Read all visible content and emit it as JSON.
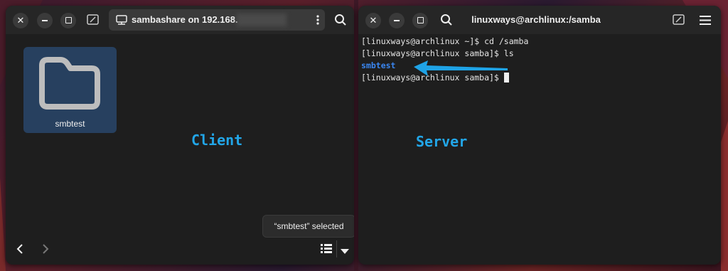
{
  "file_manager": {
    "path_label": "sambashare on 192.168.",
    "folder_name": "smbtest",
    "annotation": "Client",
    "toast": "“smbtest” selected"
  },
  "terminal": {
    "title": "linuxways@archlinux:/samba",
    "lines": [
      "[linuxways@archlinux ~]$ cd /samba",
      "[linuxways@archlinux samba]$ ls",
      "smbtest",
      "[linuxways@archlinux samba]$ "
    ],
    "annotation": "Server"
  },
  "colors": {
    "annotation": "#22a6e8",
    "folder_tile": "#27405f",
    "directory_listing": "#3a86f0"
  }
}
